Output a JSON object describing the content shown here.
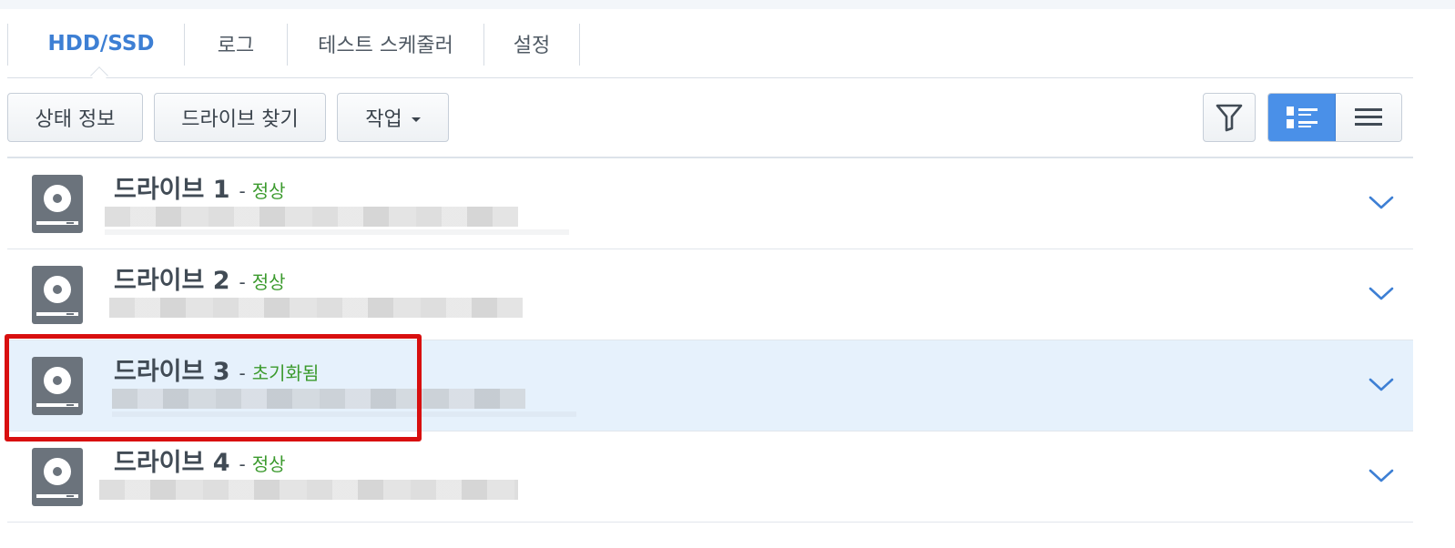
{
  "tabs": [
    {
      "label": "HDD/SSD",
      "active": true
    },
    {
      "label": "로그",
      "active": false
    },
    {
      "label": "테스트 스케줄러",
      "active": false
    },
    {
      "label": "설정",
      "active": false
    }
  ],
  "toolbar": {
    "status_info": "상태 정보",
    "find_drive": "드라이브 찾기",
    "action": "작업",
    "filter_icon": "filter-icon",
    "detail_view_icon": "detail-view-icon",
    "list_view_icon": "list-view-icon"
  },
  "drives": [
    {
      "name": "드라이브 1",
      "dash": "-",
      "status": "정상",
      "selected": false
    },
    {
      "name": "드라이브 2",
      "dash": "-",
      "status": "정상",
      "selected": false
    },
    {
      "name": "드라이브 3",
      "dash": "-",
      "status": "초기화됨",
      "selected": true
    },
    {
      "name": "드라이브 4",
      "dash": "-",
      "status": "정상",
      "selected": false
    }
  ],
  "colors": {
    "accent": "#4a90e8",
    "status_ok": "#3b9a2d",
    "selected_row": "#e6f1fc",
    "highlight": "#d80f0f"
  }
}
